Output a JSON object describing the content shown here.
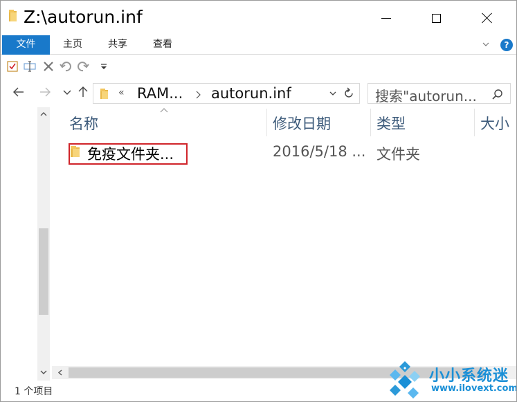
{
  "window": {
    "title": "Z:\\autorun.inf"
  },
  "ribbon": {
    "tabs": [
      "文件",
      "主页",
      "共享",
      "查看"
    ],
    "help_label": "?"
  },
  "address": {
    "overflow_marker": "«",
    "segments": [
      "RAM...",
      "autorun.inf"
    ]
  },
  "search": {
    "placeholder": "搜索\"autorun..."
  },
  "columns": [
    "名称",
    "修改日期",
    "类型",
    "大小"
  ],
  "items": [
    {
      "name": "免疫文件夹...",
      "modified": "2016/5/18 ...",
      "type": "文件夹"
    }
  ],
  "status": {
    "text": "1 个项目"
  },
  "watermark": {
    "title": "小小系统迷",
    "url": "www.ilovext.com"
  },
  "colors": {
    "accent": "#1979ca",
    "highlight_box": "#d0242a",
    "folder": "#f2c55c",
    "watermark": "#1a8fd6"
  }
}
